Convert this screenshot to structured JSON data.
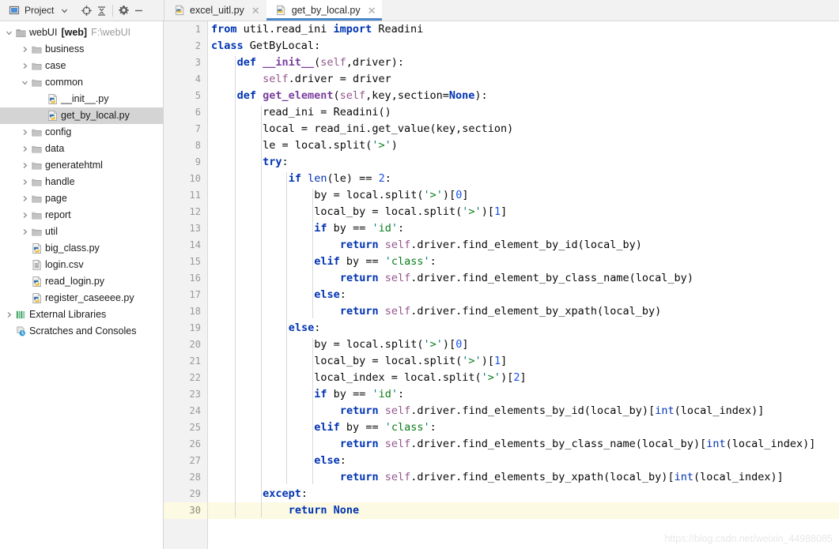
{
  "toolbar": {
    "project_label": "Project",
    "icons": [
      {
        "name": "chevron-down-icon",
        "glyph": "▾"
      },
      {
        "name": "locate-target-icon",
        "glyph": "⊕"
      },
      {
        "name": "collapse-all-icon",
        "glyph": "≢"
      },
      {
        "name": "settings-gear-icon",
        "glyph": "⚙"
      },
      {
        "name": "hide-panel-icon",
        "glyph": "—"
      }
    ]
  },
  "tabs": [
    {
      "label": "excel_uitl.py",
      "icon": "python-file-icon",
      "active": false,
      "close": "✕"
    },
    {
      "label": "get_by_local.py",
      "icon": "python-file-icon",
      "active": true,
      "close": "✕"
    }
  ],
  "tree": [
    {
      "label": "webUI",
      "bold": "[web]",
      "path": "F:\\webUI",
      "icon": "folder-root-icon",
      "arrow": "down",
      "indent": 0,
      "selected": false
    },
    {
      "label": "business",
      "icon": "folder-icon",
      "arrow": "right",
      "indent": 1,
      "selected": false
    },
    {
      "label": "case",
      "icon": "folder-icon",
      "arrow": "right",
      "indent": 1,
      "selected": false
    },
    {
      "label": "common",
      "icon": "folder-icon",
      "arrow": "down",
      "indent": 1,
      "selected": false
    },
    {
      "label": "__init__.py",
      "icon": "python-file-icon",
      "arrow": "none",
      "indent": 2,
      "selected": false
    },
    {
      "label": "get_by_local.py",
      "icon": "python-file-icon",
      "arrow": "none",
      "indent": 2,
      "selected": true
    },
    {
      "label": "config",
      "icon": "folder-icon",
      "arrow": "right",
      "indent": 1,
      "selected": false
    },
    {
      "label": "data",
      "icon": "folder-icon",
      "arrow": "right",
      "indent": 1,
      "selected": false
    },
    {
      "label": "generatehtml",
      "icon": "folder-icon",
      "arrow": "right",
      "indent": 1,
      "selected": false
    },
    {
      "label": "handle",
      "icon": "folder-icon",
      "arrow": "right",
      "indent": 1,
      "selected": false
    },
    {
      "label": "page",
      "icon": "folder-icon",
      "arrow": "right",
      "indent": 1,
      "selected": false
    },
    {
      "label": "report",
      "icon": "folder-icon",
      "arrow": "right",
      "indent": 1,
      "selected": false
    },
    {
      "label": "util",
      "icon": "folder-icon",
      "arrow": "right",
      "indent": 1,
      "selected": false
    },
    {
      "label": "big_class.py",
      "icon": "python-file-icon",
      "arrow": "none",
      "indent": 1,
      "selected": false
    },
    {
      "label": "login.csv",
      "icon": "csv-file-icon",
      "arrow": "none",
      "indent": 1,
      "selected": false
    },
    {
      "label": "read_login.py",
      "icon": "python-file-icon",
      "arrow": "none",
      "indent": 1,
      "selected": false
    },
    {
      "label": "register_caseeee.py",
      "icon": "python-file-icon",
      "arrow": "none",
      "indent": 1,
      "selected": false
    },
    {
      "label": "External Libraries",
      "icon": "libraries-icon",
      "arrow": "right",
      "indent": 0,
      "selected": false
    },
    {
      "label": "Scratches and Consoles",
      "icon": "scratches-icon",
      "arrow": "none",
      "indent": 0,
      "selected": false
    }
  ],
  "editor": {
    "current_line": 30,
    "line_numbers": [
      1,
      2,
      3,
      4,
      5,
      6,
      7,
      8,
      9,
      10,
      11,
      12,
      13,
      14,
      15,
      16,
      17,
      18,
      19,
      20,
      21,
      22,
      23,
      24,
      25,
      26,
      27,
      28,
      29,
      30
    ],
    "lines": [
      "from util.read_ini import Readini",
      "class GetByLocal:",
      "    def __init__(self,driver):",
      "        self.driver = driver",
      "    def get_element(self,key,section=None):",
      "        read_ini = Readini()",
      "        local = read_ini.get_value(key,section)",
      "        le = local.split('>')",
      "        try:",
      "            if len(le) == 2:",
      "                by = local.split('>')[0]",
      "                local_by = local.split('>')[1]",
      "                if by == 'id':",
      "                    return self.driver.find_element_by_id(local_by)",
      "                elif by == 'class':",
      "                    return self.driver.find_element_by_class_name(local_by)",
      "                else:",
      "                    return self.driver.find_element_by_xpath(local_by)",
      "            else:",
      "                by = local.split('>')[0]",
      "                local_by = local.split('>')[1]",
      "                local_index = local.split('>')[2]",
      "                if by == 'id':",
      "                    return self.driver.find_elements_by_id(local_by)[int(local_index)]",
      "                elif by == 'class':",
      "                    return self.driver.find_elements_by_class_name(local_by)[int(local_index)]",
      "                else:",
      "                    return self.driver.find_elements_by_xpath(local_by)[int(local_index)]",
      "        except:",
      "            return None"
    ]
  },
  "watermark": "https://blog.csdn.net/weixin_44988085",
  "colors": {
    "accent": "#4a86c8",
    "gutter_bg": "#f2f2f2",
    "current_line_bg": "#fcfae2",
    "selection_bg": "#d4d4d4",
    "keyword": "#0033b3",
    "string": "#067d17",
    "number": "#1750eb",
    "self_param": "#94558d",
    "function_name": "#7a3e9d"
  }
}
